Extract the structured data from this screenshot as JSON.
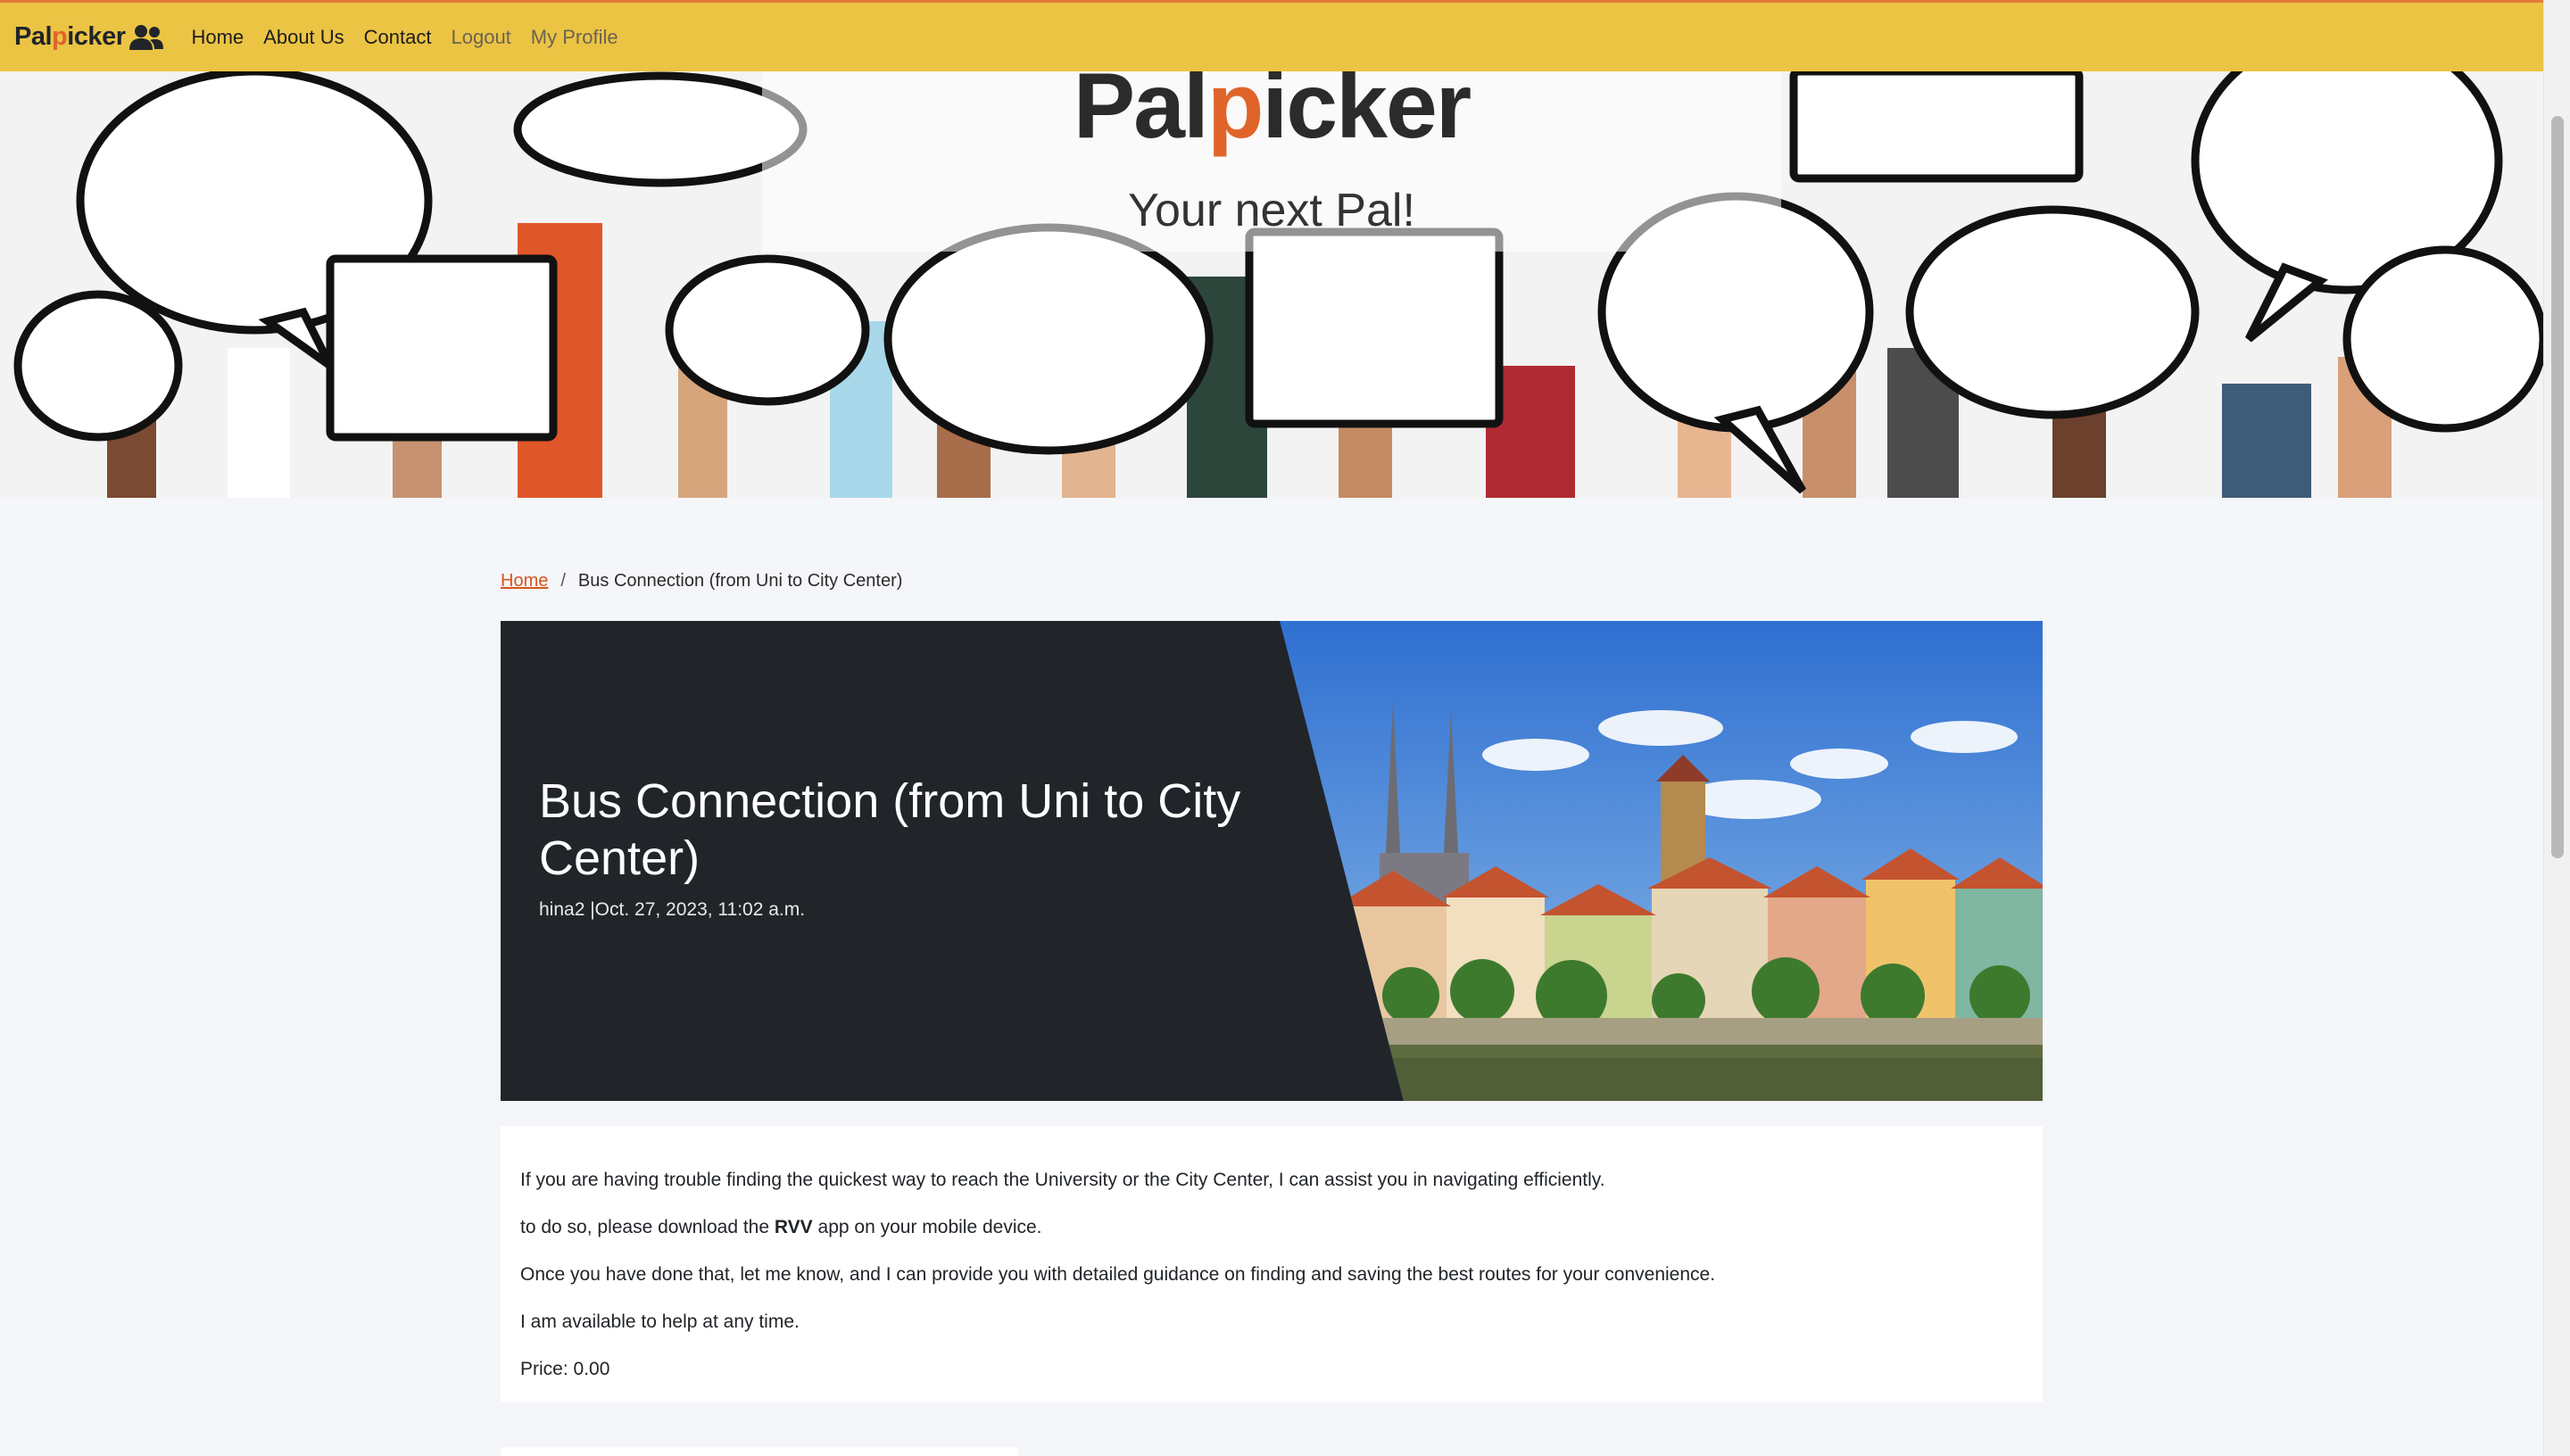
{
  "navbar": {
    "brand_prefix": "Pal",
    "brand_accent": "p",
    "brand_suffix": "icker",
    "brand_icon": "users-icon",
    "links": [
      {
        "label": "Home"
      },
      {
        "label": "About Us"
      },
      {
        "label": "Contact"
      },
      {
        "label": "Logout"
      },
      {
        "label": "My Profile"
      }
    ]
  },
  "hero": {
    "logo_prefix": "Pal",
    "logo_accent": "p",
    "logo_suffix": "icker",
    "tagline": "Your next Pal!"
  },
  "breadcrumb": {
    "home": "Home",
    "separator": "/",
    "current": "Bus Connection (from Uni to City Center)"
  },
  "post": {
    "title": "Bus Connection (from Uni to City Center)",
    "meta": "hina2 |Oct. 27, 2023, 11:02 a.m.",
    "paragraph_1": "If you are having trouble finding the quickest way to reach the University or the City Center, I can assist you in navigating efficiently.",
    "paragraph_2_before": "to do so, please download the ",
    "paragraph_2_bold": "RVV",
    "paragraph_2_after": " app on your mobile device.",
    "paragraph_3": "Once you have done that, let me know, and I can provide you with detailed guidance on finding and saving the best routes for your convenience.",
    "paragraph_4": "I am available to help at any time.",
    "price": "Price: 0.00"
  },
  "colors": {
    "navbar_bg": "#ecc444",
    "accent": "#e0642a",
    "link": "#d9531e",
    "banner_bg": "#212529",
    "page_bg": "#f4f6f9"
  }
}
